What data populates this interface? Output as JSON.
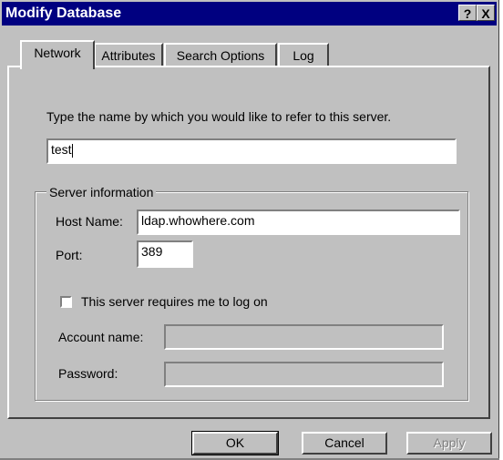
{
  "window": {
    "title": "Modify Database",
    "help_glyph": "?",
    "close_glyph": "X"
  },
  "tabs": [
    {
      "label": "Network",
      "active": true
    },
    {
      "label": "Attributes",
      "active": false
    },
    {
      "label": "Search Options",
      "active": false
    },
    {
      "label": "Log",
      "active": false
    }
  ],
  "network": {
    "prompt": "Type the name by which you would like to refer to this server.",
    "display_name_value": "test",
    "server_info": {
      "legend": "Server information",
      "host_label": "Host Name:",
      "host_value": "ldap.whowhere.com",
      "port_label": "Port:",
      "port_value": "389",
      "logon_checkbox_label": "This server requires me to log on",
      "logon_checked": false,
      "account_label": "Account name:",
      "account_value": "",
      "password_label": "Password:",
      "password_value": ""
    }
  },
  "buttons": {
    "ok": "OK",
    "cancel": "Cancel",
    "apply": "Apply"
  }
}
